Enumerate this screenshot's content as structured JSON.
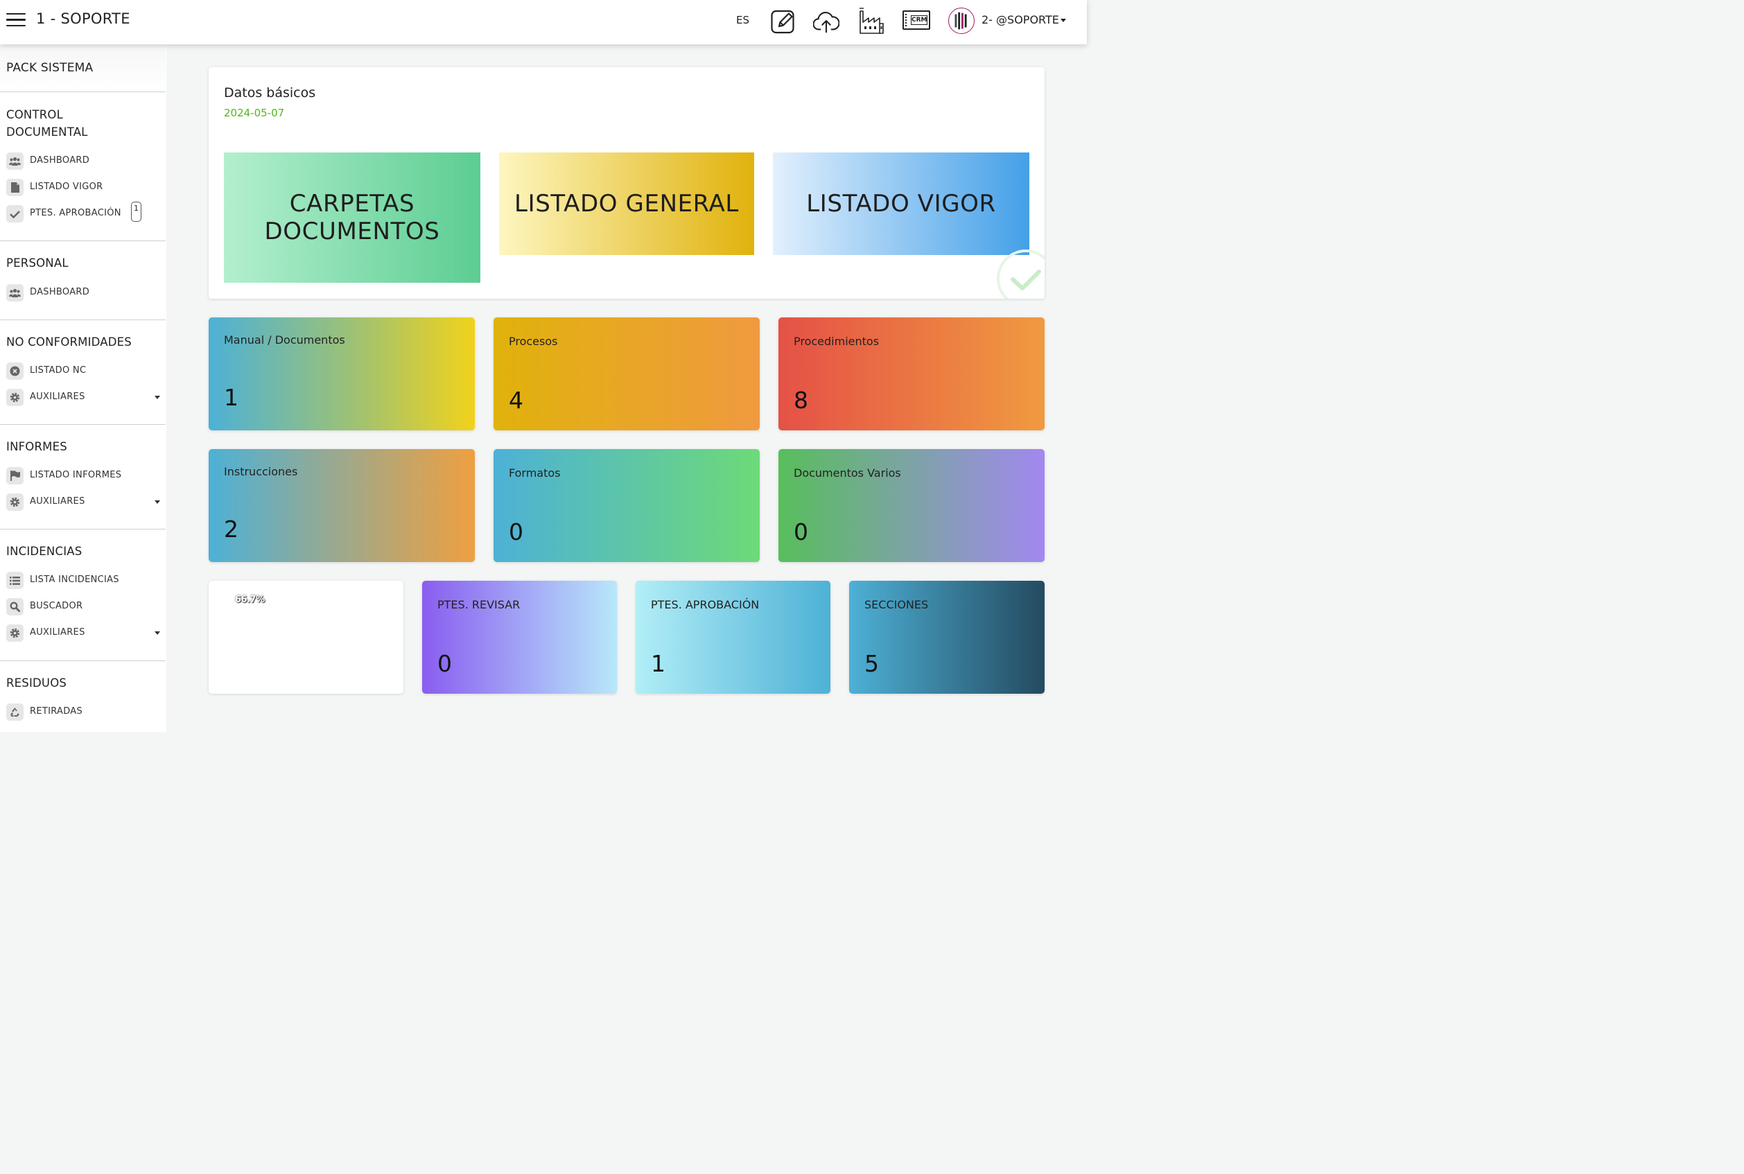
{
  "header": {
    "title": "1 - SOPORTE",
    "language": "ES",
    "user_name": "2- @SOPORTE",
    "icons": [
      "edit-icon",
      "cloud-upload-icon",
      "factory-icon",
      "crm-icon"
    ],
    "crm_label": "CRM"
  },
  "sidebar": {
    "pack_title": "PACK SISTEMA",
    "sections": [
      {
        "title": "CONTROL DOCUMENTAL",
        "title_line1": "CONTROL",
        "title_line2": "DOCUMENTAL",
        "items": [
          {
            "label": "DASHBOARD",
            "icon": "users-icon"
          },
          {
            "label": "LISTADO VIGOR",
            "icon": "file-icon"
          },
          {
            "label": "PTES. APROBACIÓN",
            "icon": "check-icon",
            "badge": "1"
          }
        ]
      },
      {
        "title": "PERSONAL",
        "items": [
          {
            "label": "DASHBOARD",
            "icon": "users-icon"
          }
        ]
      },
      {
        "title": "NO CONFORMIDADES",
        "items": [
          {
            "label": "LISTADO NC",
            "icon": "x-circle-icon"
          },
          {
            "label": "AUXILIARES",
            "icon": "gear-icon",
            "dropdown": true
          }
        ]
      },
      {
        "title": "INFORMES",
        "items": [
          {
            "label": "LISTADO INFORMES",
            "icon": "flag-icon"
          },
          {
            "label": "AUXILIARES",
            "icon": "gear-icon",
            "dropdown": true
          }
        ]
      },
      {
        "title": "INCIDENCIAS",
        "items": [
          {
            "label": "LISTA INCIDENCIAS",
            "icon": "list-icon"
          },
          {
            "label": "BUSCADOR",
            "icon": "search-icon"
          },
          {
            "label": "AUXILIARES",
            "icon": "gear-icon",
            "dropdown": true
          }
        ]
      },
      {
        "title": "RESIDUOS",
        "items": [
          {
            "label": "RETIRADAS",
            "icon": "recycle-icon"
          }
        ]
      }
    ]
  },
  "main": {
    "basic": {
      "title": "Datos básicos",
      "date": "2024-05-07",
      "tiles": [
        {
          "label": "CARPETAS DOCUMENTOS",
          "line1": "CARPETAS",
          "line2": "DOCUMENTOS"
        },
        {
          "label": "LISTADO GENERAL"
        },
        {
          "label": "LISTADO VIGOR"
        }
      ]
    },
    "stats": [
      {
        "label": "Manual / Documentos",
        "value": "1"
      },
      {
        "label": "Procesos",
        "value": "4"
      },
      {
        "label": "Procedimientos",
        "value": "8"
      },
      {
        "label": "Instrucciones",
        "value": "2"
      },
      {
        "label": "Formatos",
        "value": "0"
      },
      {
        "label": "Documentos Varios",
        "value": "0"
      }
    ],
    "progress_text": "66.7%",
    "bottom_stats": [
      {
        "label": "PTES. REVISAR",
        "value": "0"
      },
      {
        "label": "PTES. APROBACIÓN",
        "value": "1"
      },
      {
        "label": "SECCIONES",
        "value": "5"
      }
    ]
  },
  "colors": {
    "date_green": "#4fb81a",
    "tile_green": [
      "#b3efce",
      "#5ccd92"
    ],
    "tile_yellow": [
      "#fdf6c0",
      "#e0b20c"
    ],
    "tile_blue": [
      "#e2f0fd",
      "#44a0e8"
    ]
  }
}
